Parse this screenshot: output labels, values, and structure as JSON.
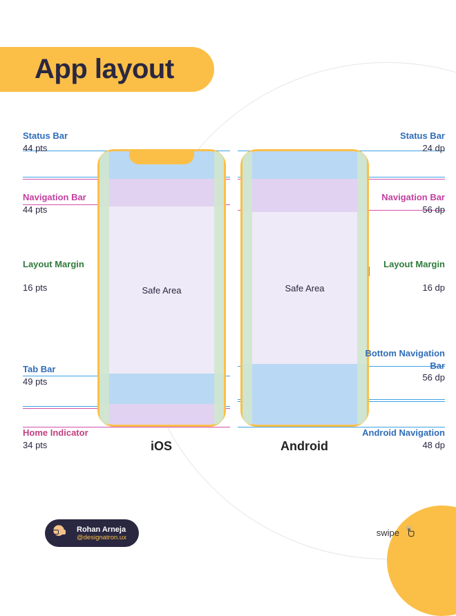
{
  "heading": "App layout",
  "ios": {
    "label": "iOS",
    "safe_area": "Safe Area",
    "status_bar": {
      "title": "Status Bar",
      "value": "44 pts"
    },
    "nav_bar": {
      "title": "Navigation Bar",
      "value": "44 pts"
    },
    "layout_margin": {
      "title": "Layout Margin",
      "value": "16 pts"
    },
    "tab_bar": {
      "title": "Tab Bar",
      "value": "49 pts"
    },
    "home_ind": {
      "title": "Home Indicator",
      "value": "34 pts"
    }
  },
  "android": {
    "label": "Android",
    "safe_area": "Safe Area",
    "status_bar": {
      "title": "Status Bar",
      "value": "24 dp"
    },
    "nav_bar": {
      "title": "Navigation Bar",
      "value": "56 dp"
    },
    "layout_margin": {
      "title": "Layout Margin",
      "value": "16 dp"
    },
    "bottom_nav": {
      "title": "Bottom Navigation Bar",
      "value": "56 dp"
    },
    "and_nav": {
      "title": "Android Navigation",
      "value": "48 dp"
    }
  },
  "author": {
    "name": "Rohan Arneja",
    "handle": "@designatron.ux"
  },
  "swipe_label": "swipe",
  "colors": {
    "accent": "#fbbf47",
    "blue_tint": "#b9d8f4",
    "purple_tint": "#e0d2f0",
    "green_tint": "#cfe7ce"
  }
}
